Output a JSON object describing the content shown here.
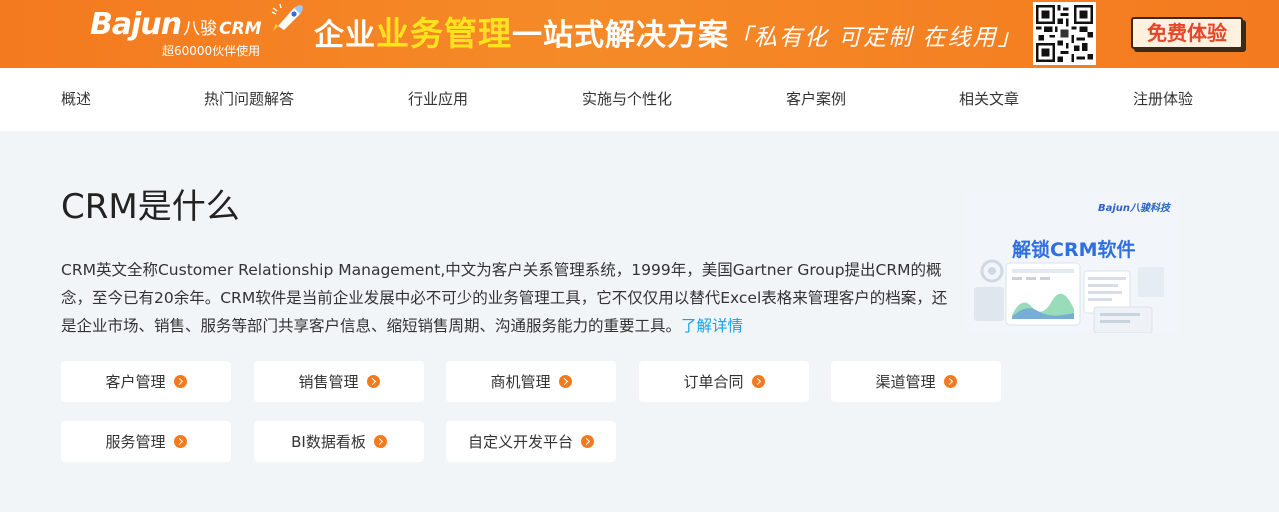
{
  "banner": {
    "logo": {
      "brand": "Bajun",
      "brand_cn": "八骏",
      "product": "CRM",
      "tagline": "超60000伙伴使用"
    },
    "slogan": {
      "part1": "企业",
      "highlight": "业务管理",
      "part2": "一站式解决方案",
      "tail": "「私有化 可定制 在线用」"
    },
    "cta_label": "免费体验",
    "colors": {
      "background": "#f47a1f",
      "highlight": "#ffe21f",
      "cta_text": "#e8462b"
    }
  },
  "nav": {
    "items": [
      {
        "label": "概述"
      },
      {
        "label": "热门问题解答"
      },
      {
        "label": "行业应用"
      },
      {
        "label": "实施与个性化"
      },
      {
        "label": "客户案例"
      },
      {
        "label": "相关文章"
      },
      {
        "label": "注册体验"
      }
    ]
  },
  "main": {
    "title": "CRM是什么",
    "description": "CRM英文全称Customer Relationship Management,中文为客户关系管理系统，1999年，美国Gartner Group提出CRM的概念，至今已有20余年。CRM软件是当前企业发展中必不可少的业务管理工具，它不仅仅用以替代Excel表格来管理客户的档案，还是企业市场、销售、服务等部门共享客户信息、缩短销售周期、沟通服务能力的重要工具。",
    "more_link": "了解详情",
    "ad": {
      "logo": "Bajun八骏科技",
      "text": "解锁CRM软件"
    },
    "features": [
      {
        "label": "客户管理"
      },
      {
        "label": "销售管理"
      },
      {
        "label": "商机管理"
      },
      {
        "label": "订单合同"
      },
      {
        "label": "渠道管理"
      },
      {
        "label": "服务管理"
      },
      {
        "label": "BI数据看板"
      },
      {
        "label": "自定义开发平台"
      }
    ],
    "colors": {
      "accent": "#f47a1f",
      "link": "#1aa1e8"
    }
  }
}
